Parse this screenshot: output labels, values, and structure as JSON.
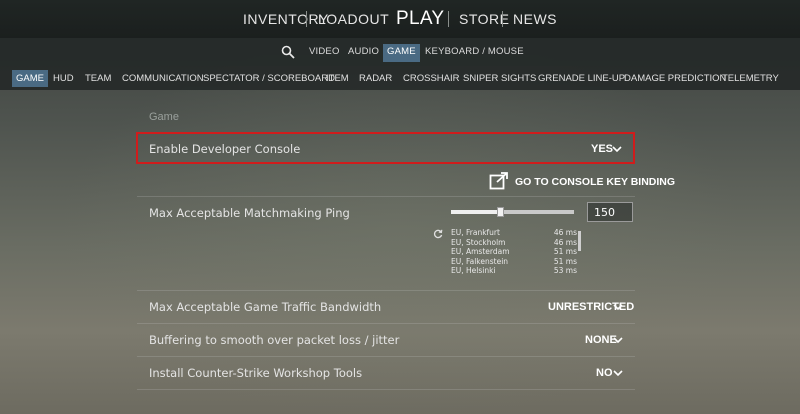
{
  "topnav": {
    "inventory": "INVENTORY",
    "loadout": "LOADOUT",
    "play": "PLAY",
    "store": "STORE",
    "news": "NEWS"
  },
  "settings_tabs": [
    "VIDEO",
    "AUDIO",
    "GAME",
    "KEYBOARD / MOUSE"
  ],
  "active_settings_tab": "GAME",
  "categories": [
    "GAME",
    "HUD",
    "TEAM",
    "COMMUNICATION",
    "SPECTATOR / SCOREBOARD",
    "ITEM",
    "RADAR",
    "CROSSHAIR",
    "SNIPER SIGHTS",
    "GRENADE LINE-UP",
    "DAMAGE PREDICTION",
    "TELEMETRY"
  ],
  "active_category": "GAME",
  "section_title": "Game",
  "rows": {
    "dev_console": {
      "label": "Enable Developer Console",
      "value": "YES"
    },
    "keybind_link": "GO TO CONSOLE KEY BINDING",
    "ping": {
      "label": "Max Acceptable Matchmaking Ping",
      "value": "150",
      "slider_fraction": 0.4
    },
    "bandwidth": {
      "label": "Max Acceptable Game Traffic Bandwidth",
      "value": "UNRESTRICTED"
    },
    "buffering": {
      "label": "Buffering to smooth over packet loss / jitter",
      "value": "NONE"
    },
    "workshop": {
      "label": "Install Counter-Strike Workshop Tools",
      "value": "NO"
    }
  },
  "servers": [
    {
      "name": "EU, Frankfurt",
      "ping": "46 ms"
    },
    {
      "name": "EU, Stockholm",
      "ping": "46 ms"
    },
    {
      "name": "EU, Amsterdam",
      "ping": "51 ms"
    },
    {
      "name": "EU, Falkenstein",
      "ping": "51 ms"
    },
    {
      "name": "EU, Helsinki",
      "ping": "53 ms"
    }
  ],
  "colors": {
    "accent_tab": "#4a6a83",
    "highlight_border": "#d01c1c"
  },
  "icons": {
    "search": "search-icon",
    "external_link": "external-link-icon",
    "refresh": "refresh-icon",
    "chevron": "chevron-down-icon"
  }
}
